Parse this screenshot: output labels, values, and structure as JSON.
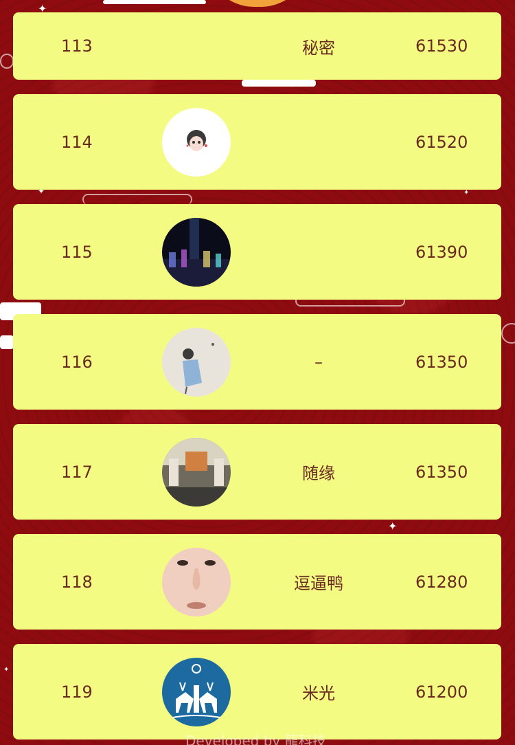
{
  "leaderboard": {
    "rows": [
      {
        "rank": "113",
        "name": "秘密",
        "score": "61530",
        "avatar": "none"
      },
      {
        "rank": "114",
        "name": "",
        "score": "61520",
        "avatar": "cartoon-girl-avatar"
      },
      {
        "rank": "115",
        "name": "",
        "score": "61390",
        "avatar": "night-fountain-avatar"
      },
      {
        "rank": "116",
        "name": "–",
        "score": "61350",
        "avatar": "girl-illustration-avatar"
      },
      {
        "rank": "117",
        "name": "随缘",
        "score": "61350",
        "avatar": "interior-room-avatar"
      },
      {
        "rank": "118",
        "name": "逗逼鸭",
        "score": "61280",
        "avatar": "face-closeup-avatar"
      },
      {
        "rank": "119",
        "name": "米光",
        "score": "61200",
        "avatar": "deer-papercut-avatar"
      }
    ]
  },
  "footer": {
    "text": "Developed by 龍科技"
  },
  "colors": {
    "background": "#8e0c10",
    "row_bg": "#f3fb82",
    "text": "#6b2a1f"
  }
}
